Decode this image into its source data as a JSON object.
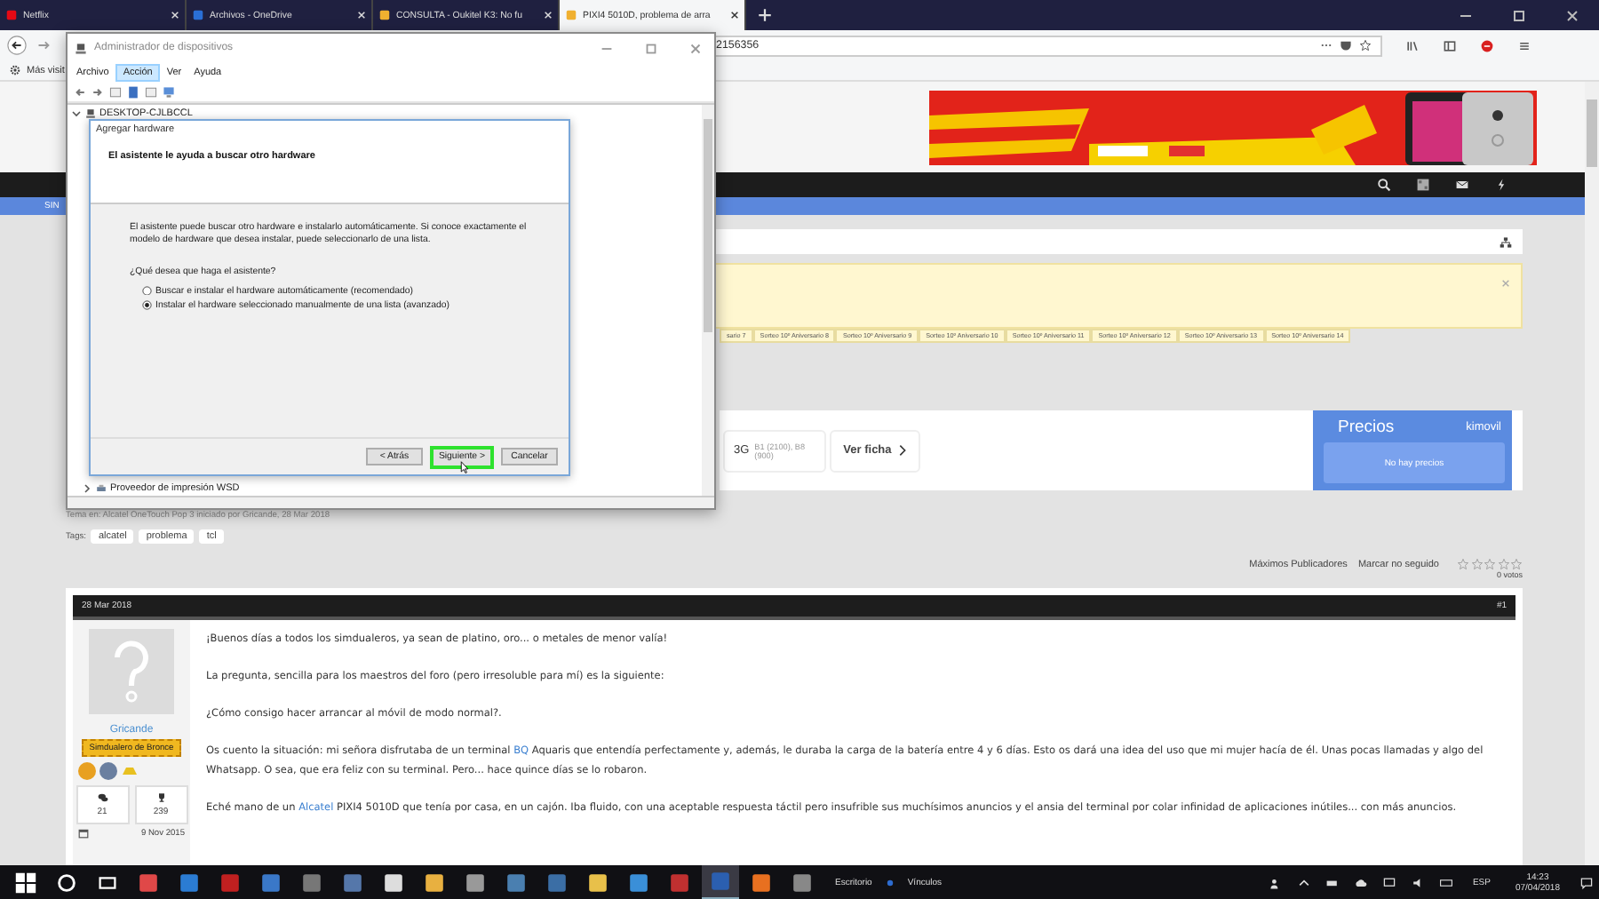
{
  "browser": {
    "tabs": [
      {
        "label": "Netflix",
        "selected": false
      },
      {
        "label": "Archivos - OneDrive",
        "selected": false
      },
      {
        "label": "CONSULTA - Oukitel K3: No fu",
        "selected": false
      },
      {
        "label": "PIXI4 5010D, problema de arra",
        "selected": true
      }
    ],
    "address": "2156356",
    "bookmarks": [
      "Más visit"
    ]
  },
  "forum": {
    "section_tab": "SIN",
    "lottery_tabs": [
      "sario 7",
      "Sorteo 10º Aniversario 8",
      "Sorteo 10º Aniversario 9",
      "Sorteo 10º Aniversario 10",
      "Sorteo 10º Aniversario 11",
      "Sorteo 10º Aniversario 12",
      "Sorteo 10º Aniversario 13",
      "Sorteo 10º Aniversario 14"
    ],
    "device_widget": {
      "network": "3G",
      "bands": "B1 (2100), B8 (900)",
      "link": "Ver ficha",
      "prices_title": "Precios",
      "brand": "kimovil",
      "prices_note": "No hay precios"
    },
    "thread_info": "Tema en: Alcatel OneTouch Pop 3 iniciado por Gricande, 28 Mar 2018",
    "tags": {
      "label": "Tags:",
      "items": [
        "alcatel",
        "problema",
        "tcl"
      ]
    },
    "thread_tools": {
      "links": [
        "Máximos Publicadores",
        "Marcar no seguido"
      ],
      "stars": 0,
      "votes": "0 votos"
    },
    "post": {
      "date": "28 Mar 2018",
      "number": "#1",
      "author": "Gricande",
      "rank": "Simdualero de Bronce",
      "messages": "21",
      "trophies": "239",
      "joined": "9 Nov 2015",
      "paragraphs": [
        [
          {
            "text": "¡Buenos días a todos los simdualeros, ya sean de platino, oro... o metales de menor valía!",
            "link": false
          }
        ],
        [
          {
            "text": "La pregunta, sencilla para los maestros del foro (pero irresoluble para mí) es la siguiente:",
            "link": false
          }
        ],
        [
          {
            "text": "¿Cómo consigo hacer arrancar al móvil de modo normal?.",
            "link": false
          }
        ],
        [
          {
            "text": "Os cuento la situación: mi señora disfrutaba de un terminal ",
            "link": false
          },
          {
            "text": "BQ",
            "link": true
          },
          {
            "text": " Aquaris que entendía perfectamente y, además, le duraba la carga de la batería entre 4 y 6 días. Esto os dará una idea del uso que mi mujer hacía de él. Unas pocas llamadas y algo del Whatsapp. O sea, que era feliz con su terminal. Pero... hace quince días se lo robaron.",
            "link": false
          }
        ],
        [
          {
            "text": "Eché mano de un ",
            "link": false
          },
          {
            "text": "Alcatel",
            "link": true
          },
          {
            "text": " PIXI4 5010D que tenía por casa, en un cajón. Iba fluido, con una aceptable respuesta táctil pero insufrible sus muchísimos anuncios y el ansia del terminal por colar infinidad de aplicaciones inútiles... con más anuncios.",
            "link": false
          }
        ]
      ]
    }
  },
  "device_manager": {
    "title": "Administrador de dispositivos",
    "menu": [
      {
        "label": "Archivo",
        "selected": false
      },
      {
        "label": "Acción",
        "selected": true
      },
      {
        "label": "Ver",
        "selected": false
      },
      {
        "label": "Ayuda",
        "selected": false
      }
    ],
    "tree_root": "DESKTOP-CJLBCCL",
    "tree_items": [
      "Proveedor de impresión WSD"
    ],
    "wizard": {
      "title": "Agregar hardware",
      "heading": "El asistente le ayuda a buscar otro hardware",
      "description": "El asistente puede buscar otro hardware e instalarlo automáticamente. Si conoce exactamente el modelo de hardware que desea instalar, puede seleccionarlo de una lista.",
      "question": "¿Qué desea que haga el asistente?",
      "options": [
        {
          "label": "Buscar e instalar el hardware automáticamente (recomendado)",
          "selected": false
        },
        {
          "label": "Instalar el hardware seleccionado manualmente de una lista (avanzado)",
          "selected": true
        }
      ],
      "buttons": [
        {
          "label": "< Atrás",
          "highlighted": false
        },
        {
          "label": "Siguiente >",
          "highlighted": true
        },
        {
          "label": "Cancelar",
          "highlighted": false
        }
      ]
    }
  },
  "taskbar": {
    "toolbar": "Escritorio",
    "links": "Vínculos",
    "language": "ESP",
    "time": "14:23",
    "date": "07/04/2018"
  }
}
